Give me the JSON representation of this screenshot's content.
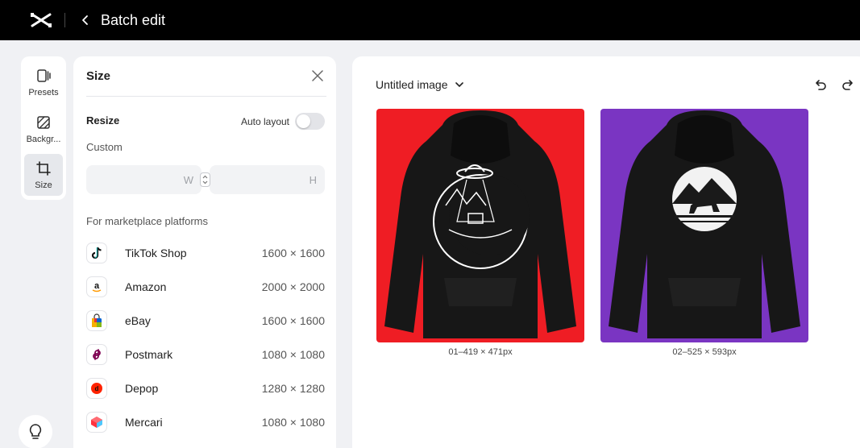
{
  "topbar": {
    "title": "Batch edit"
  },
  "rail": {
    "items": [
      {
        "label": "Presets",
        "icon": "presets-icon"
      },
      {
        "label": "Backgr...",
        "icon": "background-icon"
      },
      {
        "label": "Size",
        "icon": "crop-resize-icon"
      }
    ]
  },
  "panel": {
    "title": "Size",
    "resize_label": "Resize",
    "auto_layout_label": "Auto layout",
    "auto_layout_on": false,
    "custom_label": "Custom",
    "width_placeholder": "W",
    "height_placeholder": "H",
    "marketplace_label": "For marketplace platforms",
    "platforms": [
      {
        "name": "TikTok Shop",
        "size": "1600 × 1600",
        "icon": "tiktok-icon"
      },
      {
        "name": "Amazon",
        "size": "2000 × 2000",
        "icon": "amazon-icon"
      },
      {
        "name": "eBay",
        "size": "1600 × 1600",
        "icon": "ebay-bag-icon"
      },
      {
        "name": "Postmark",
        "size": "1080 × 1080",
        "icon": "poshmark-icon"
      },
      {
        "name": "Depop",
        "size": "1280 × 1280",
        "icon": "depop-icon"
      },
      {
        "name": "Mercari",
        "size": "1080 × 1080",
        "icon": "mercari-icon"
      }
    ]
  },
  "canvas": {
    "doc_name": "Untitled image",
    "images": [
      {
        "caption": "01–419 × 471px",
        "background": "#ef1d24"
      },
      {
        "caption": "02–525 × 593px",
        "background": "#7a35c2"
      }
    ]
  },
  "colors": {
    "topbar": "#000000",
    "page_bg": "#f0f1f4",
    "panel_bg": "#ffffff"
  }
}
